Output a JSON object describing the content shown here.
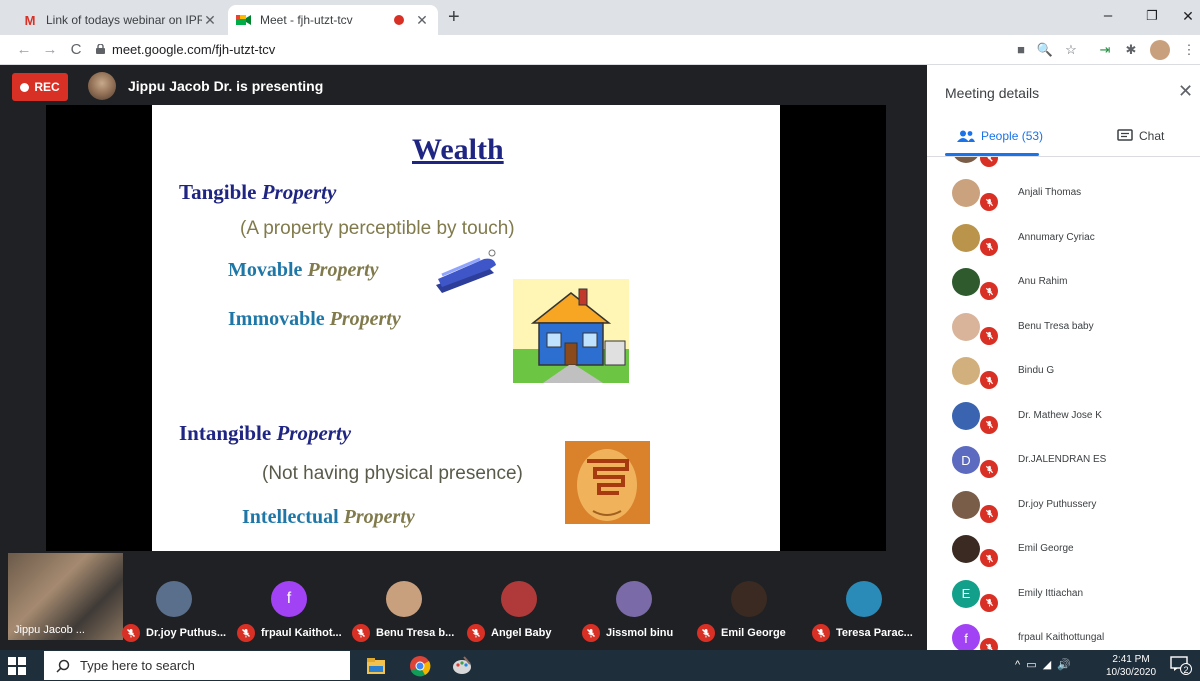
{
  "browser": {
    "tabs": [
      {
        "title": "Link of todays webinar on IPR - s",
        "icon": "gmail-icon"
      },
      {
        "title": "Meet - fjh-utzt-tcv",
        "icon": "meet-icon",
        "recording": true
      }
    ],
    "url": "meet.google.com/fjh-utzt-tcv"
  },
  "meet": {
    "rec_label": "REC",
    "presenting_text": "Jippu Jacob Dr. is presenting",
    "colors": {
      "rec": "#d93025",
      "accent": "#1a73e8",
      "stage": "#202124"
    }
  },
  "slide": {
    "title": "Wealth",
    "tangible_main": "Tangible",
    "tangible_suffix": "Property",
    "tangible_desc": "(A property perceptible by touch)",
    "movable_main": "Movable",
    "movable_suffix": "Property",
    "immovable_main": "Immovable",
    "immovable_suffix": "Property",
    "intangible_main": "Intangible",
    "intangible_suffix": "Property",
    "intangible_desc": "(Not having physical presence)",
    "intellectual_main": "Intellectual",
    "intellectual_suffix": "Property"
  },
  "filmstrip": {
    "self_name": "Jippu Jacob ...",
    "tiles": [
      {
        "name": "Dr.joy Puthus...",
        "avatar_color": "#5a6f8c"
      },
      {
        "name": "frpaul Kaithot...",
        "initial": "f",
        "avatar_color": "#a142f4"
      },
      {
        "name": "Benu Tresa b...",
        "avatar_color": "#c9a07e"
      },
      {
        "name": "Angel Baby",
        "avatar_color": "#b03a3a"
      },
      {
        "name": "Jissmol binu",
        "avatar_color": "#7a6aa8"
      },
      {
        "name": "Emil George",
        "avatar_color": "#3a2a22"
      },
      {
        "name": "Teresa Parac...",
        "avatar_color": "#2a8ab8"
      }
    ]
  },
  "panel": {
    "title": "Meeting details",
    "people_tab": "People (53)",
    "chat_tab": "Chat",
    "people": [
      {
        "name": "Anjali Thomas",
        "avatar_color": "#caa27e"
      },
      {
        "name": "Annumary Cyriac",
        "avatar_color": "#b9944a"
      },
      {
        "name": "Anu Rahim",
        "avatar_color": "#2e5a2e"
      },
      {
        "name": "Benu Tresa baby",
        "avatar_color": "#d9b49a"
      },
      {
        "name": "Bindu G",
        "avatar_color": "#d2b07e"
      },
      {
        "name": "Dr. Mathew Jose K",
        "avatar_color": "#3a64b0"
      },
      {
        "name": "Dr.JALENDRAN ES",
        "initial": "D",
        "avatar_color": "#5c6bc0"
      },
      {
        "name": "Dr.joy Puthussery",
        "avatar_color": "#7a5d48"
      },
      {
        "name": "Emil George",
        "avatar_color": "#3a2a22"
      },
      {
        "name": "Emily Ittiachan",
        "initial": "E",
        "avatar_color": "#12a08a"
      },
      {
        "name": "frpaul Kaithottungal",
        "initial": "f",
        "avatar_color": "#a142f4"
      }
    ]
  },
  "taskbar": {
    "search_placeholder": "Type here to search",
    "time": "2:41 PM",
    "date": "10/30/2020",
    "notification_count": "2"
  }
}
